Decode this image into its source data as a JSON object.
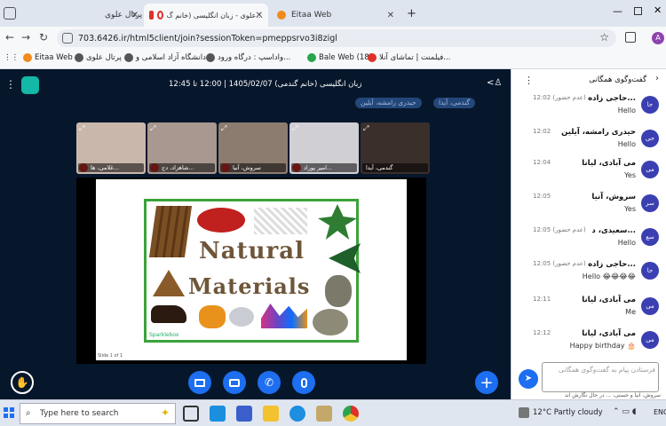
{
  "browser": {
    "tabs": [
      {
        "label": "پرتال علوی"
      },
      {
        "label": "علوی - زبان انگلیسی (خانم گ..."
      },
      {
        "label": "Eitaa Web"
      }
    ],
    "new_tab": "+",
    "url": "703.6426.ir/html5client/join?sessionToken=pmeppsrvo3i8zigl",
    "bookmarks": [
      {
        "label": "Eitaa Web"
      },
      {
        "label": "پرتال علوی"
      },
      {
        "label": "دانشگاه آزاد اسلامی و..."
      },
      {
        "label": "واداسپ : درگاه ورود..."
      },
      {
        "label": "Bale Web (18)"
      },
      {
        "label": "فیلمنت | تماشای آنلا..."
      }
    ],
    "profile_initial": "A"
  },
  "meeting": {
    "title": "زبان انگلیسی (خانم گندمی) 1405/02/07 | 12:00 تا 12:45",
    "talking": [
      "گندمی، آیدا",
      "حیدری رامشه، آیلین"
    ],
    "videos": [
      {
        "name": "غلامی، ها...",
        "color": "#c9b7ac"
      },
      {
        "name": "شاهزاد، دج...",
        "color": "#a89890"
      },
      {
        "name": "سروش، آنیا",
        "color": "#8c7c70"
      },
      {
        "name": "امیر پوراد...",
        "color": "#d0cfd4"
      },
      {
        "name": "گندمی، آیدا",
        "color": "#3b2f2c"
      }
    ],
    "slide": {
      "title_line1": "Natural",
      "title_line2": "Materials",
      "footer": "Sparklebox",
      "border_color": "#3aa33a",
      "page_label": "Slide 1 of 1"
    },
    "controls": [
      "share-screen",
      "camera",
      "phone",
      "microphone"
    ]
  },
  "chat": {
    "header": "گفت‌وگوی همگانی",
    "messages": [
      {
        "avatar": "حا",
        "name": "حاجی زاده...",
        "time": "12:02 (عدم حضور)",
        "text": "Hello"
      },
      {
        "avatar": "حی",
        "name": "حیدری رامشه، آیلین",
        "time": "12:02",
        "text": "Hello"
      },
      {
        "avatar": "می",
        "name": "می آبادی، لیانا",
        "time": "12:04",
        "text": "Yes"
      },
      {
        "avatar": "سر",
        "name": "سروش، آنیا",
        "time": "12:05",
        "text": "Yes"
      },
      {
        "avatar": "سع",
        "name": "سعیدی، د...",
        "time": "12:05 (عدم حضور)",
        "text": "Hello"
      },
      {
        "avatar": "حا",
        "name": "حاجی زاده...",
        "time": "12:05 (عدم حضور)",
        "text": "Hello 😂😂😂😂"
      },
      {
        "avatar": "می",
        "name": "می آبادی، لیانا",
        "time": "12:11",
        "text": "Me"
      },
      {
        "avatar": "می",
        "name": "می آبادی، لیانا",
        "time": "12:12",
        "text": "Happy birthday 🎂"
      }
    ],
    "input_placeholder": "فرستادن پیام به گفت‌وگوی همگانی",
    "typing": "سروش، آنیا و حسنی، ... در حال نگارش اند"
  },
  "taskbar": {
    "search_placeholder": "Type here to search",
    "weather": "12°C  Partly cloudy",
    "lang": "ENG"
  }
}
